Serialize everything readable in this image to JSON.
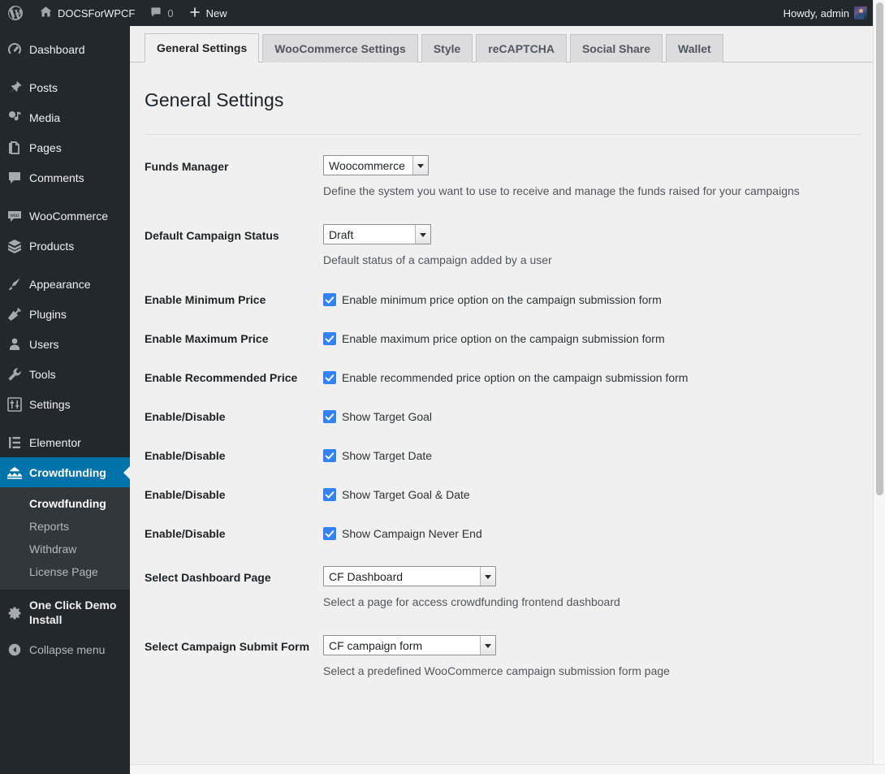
{
  "adminbar": {
    "logo_icon": "wordpress-logo-icon",
    "site_name": "DOCSForWPCF",
    "home_icon": "home-icon",
    "comments_icon": "comment-bubble-icon",
    "comments_count": "0",
    "new_icon": "plus-icon",
    "new_label": "New",
    "howdy": "Howdy, admin",
    "avatar_icon": "user-avatar"
  },
  "sidebar": {
    "items": [
      {
        "label": "Dashboard",
        "icon": "dashboard-icon",
        "current": false
      },
      {
        "label": "Posts",
        "icon": "pin-icon",
        "current": false
      },
      {
        "label": "Media",
        "icon": "media-icon",
        "current": false
      },
      {
        "label": "Pages",
        "icon": "pages-icon",
        "current": false
      },
      {
        "label": "Comments",
        "icon": "comments-icon",
        "current": false
      },
      {
        "label": "WooCommerce",
        "icon": "woocommerce-icon",
        "current": false
      },
      {
        "label": "Products",
        "icon": "products-box-icon",
        "current": false
      },
      {
        "label": "Appearance",
        "icon": "appearance-brush-icon",
        "current": false
      },
      {
        "label": "Plugins",
        "icon": "plugins-plug-icon",
        "current": false
      },
      {
        "label": "Users",
        "icon": "users-icon",
        "current": false
      },
      {
        "label": "Tools",
        "icon": "tools-wrench-icon",
        "current": false
      },
      {
        "label": "Settings",
        "icon": "settings-sliders-icon",
        "current": false
      },
      {
        "label": "Elementor",
        "icon": "elementor-icon",
        "current": false
      },
      {
        "label": "Crowdfunding",
        "icon": "crowdfunding-icon",
        "current": true
      }
    ],
    "submenu": [
      {
        "label": "Crowdfunding",
        "current": true
      },
      {
        "label": "Reports",
        "current": false
      },
      {
        "label": "Withdraw",
        "current": false
      },
      {
        "label": "License Page",
        "current": false
      }
    ],
    "demo_install": {
      "label": "One Click Demo Install",
      "icon": "gear-icon"
    },
    "collapse": {
      "label": "Collapse menu",
      "icon": "collapse-arrow-icon"
    }
  },
  "tabs": [
    {
      "label": "General Settings",
      "active": true
    },
    {
      "label": "WooCommerce Settings",
      "active": false
    },
    {
      "label": "Style",
      "active": false
    },
    {
      "label": "reCAPTCHA",
      "active": false
    },
    {
      "label": "Social Share",
      "active": false
    },
    {
      "label": "Wallet",
      "active": false
    }
  ],
  "page": {
    "title": "General Settings"
  },
  "fields": {
    "funds_manager": {
      "label": "Funds Manager",
      "value": "Woocommerce",
      "options": [
        "Woocommerce"
      ],
      "description": "Define the system you want to use to receive and manage the funds raised for your campaigns"
    },
    "default_campaign_status": {
      "label": "Default Campaign Status",
      "value": "Draft",
      "options": [
        "Draft"
      ],
      "description": "Default status of a campaign added by a user"
    },
    "enable_minimum_price": {
      "label": "Enable Minimum Price",
      "checkbox_label": "Enable minimum price option on the campaign submission form",
      "checked": true
    },
    "enable_maximum_price": {
      "label": "Enable Maximum Price",
      "checkbox_label": "Enable maximum price option on the campaign submission form",
      "checked": true
    },
    "enable_recommended_price": {
      "label": "Enable Recommended Price",
      "checkbox_label": "Enable recommended price option on the campaign submission form",
      "checked": true
    },
    "show_target_goal": {
      "label": "Enable/Disable",
      "checkbox_label": "Show Target Goal",
      "checked": true
    },
    "show_target_date": {
      "label": "Enable/Disable",
      "checkbox_label": "Show Target Date",
      "checked": true
    },
    "show_target_goal_date": {
      "label": "Enable/Disable",
      "checkbox_label": "Show Target Goal & Date",
      "checked": true
    },
    "show_campaign_never_end": {
      "label": "Enable/Disable",
      "checkbox_label": "Show Campaign Never End",
      "checked": true
    },
    "select_dashboard_page": {
      "label": "Select Dashboard Page",
      "value": "CF Dashboard",
      "options": [
        "CF Dashboard"
      ],
      "description": "Select a page for access crowdfunding frontend dashboard"
    },
    "select_campaign_submit_form": {
      "label": "Select Campaign Submit Form",
      "value": "CF campaign form",
      "options": [
        "CF campaign form"
      ],
      "description": "Select a predefined WooCommerce campaign submission form page"
    }
  },
  "colors": {
    "admin_bar": "#23282d",
    "sidebar": "#23282d",
    "submenu": "#32373c",
    "current_menu": "#0073aa",
    "content_bg": "#f0f0f1",
    "checkbox": "#3582f4"
  }
}
